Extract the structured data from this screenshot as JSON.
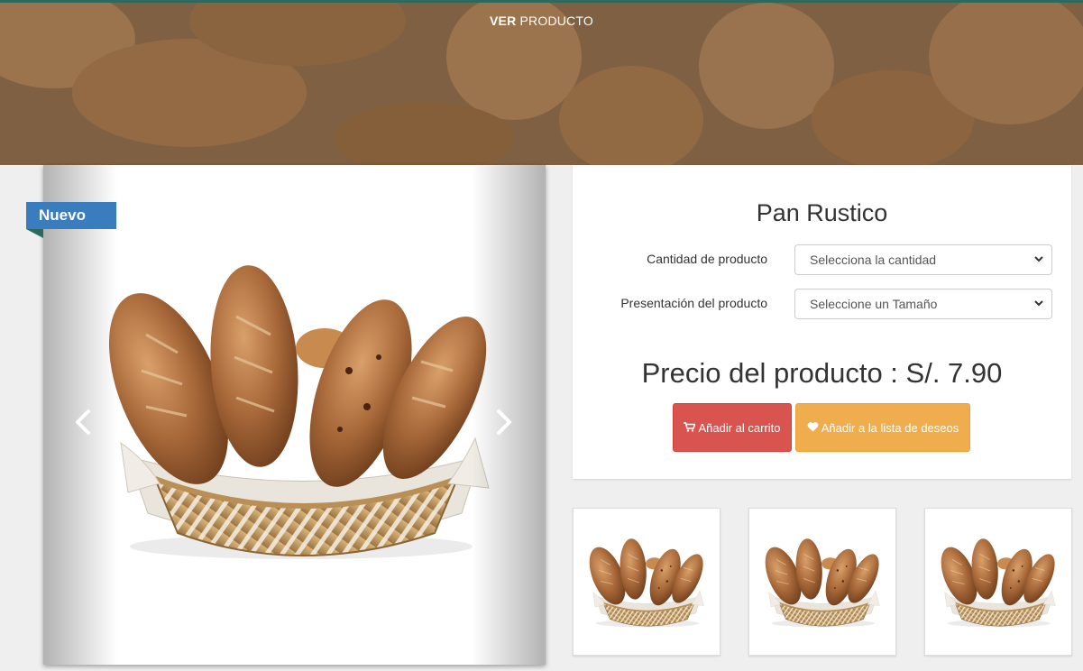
{
  "hero": {
    "title_bold": "VER",
    "title_rest": "PRODUCTO"
  },
  "carousel": {
    "badge": "Nuevo",
    "prev_icon": "chevron-left-icon",
    "next_icon": "chevron-right-icon"
  },
  "product": {
    "name": "Pan Rustico",
    "quantity_label": "Cantidad de producto",
    "quantity_value": "Selecciona la cantidad",
    "size_label": "Presentación del producto",
    "size_value": "Seleccione un Tamaño",
    "price_text": "Precio del producto : S/. 7.90"
  },
  "buttons": {
    "cart_label": "Añadir al carrito",
    "cart_icon": "shopping-cart-icon",
    "wishlist_label": "Añadir a la lista de deseos",
    "wishlist_icon": "heart-icon"
  },
  "colors": {
    "badge": "#3a7dbf",
    "cart_button": "#d9534f",
    "wishlist_button": "#f0ad4e",
    "accent": "#2d6a5d"
  }
}
